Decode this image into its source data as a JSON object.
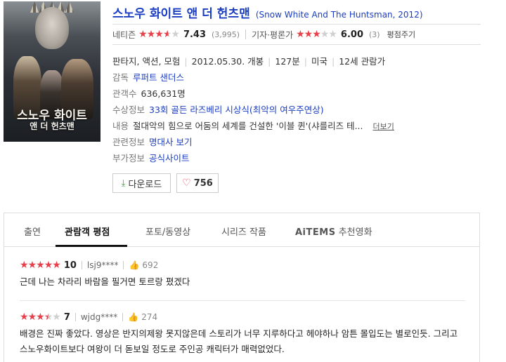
{
  "movie": {
    "title_ko": "스노우 화이트 앤 더 헌츠맨",
    "title_en": "(Snow White And The Huntsman, 2012)",
    "poster_title": "스노우 화이트",
    "poster_subtitle": "앤 더 헌츠맨"
  },
  "ratings": {
    "netizen": {
      "label": "네티즌",
      "score": "7.43",
      "count": "(3,995)",
      "stars": 3.7
    },
    "critic": {
      "label": "기자·평론가",
      "score": "6.00",
      "count": "(3)",
      "stars": 3.0
    },
    "rate_button": "평점주기"
  },
  "info": {
    "genre": "판타지, 액션, 모험",
    "release": "2012.05.30. 개봉",
    "runtime": "127분",
    "country": "미국",
    "age": "12세 관람가",
    "director_label": "감독",
    "director": "루퍼트 샌더스",
    "audience_label": "관객수",
    "audience": "636,631명",
    "awards_label": "수상정보",
    "awards": "33회 골든 라즈베리 시상식(최악의 여우주연상)",
    "plot_label": "내용",
    "plot": "절대악의 힘으로 어둠의 세계를 건설한 '이블 퀸'(샤를리즈 테...",
    "more": "더보기",
    "related_label": "관련정보",
    "related": "명대사 보기",
    "extra_label": "부가정보",
    "extra": "공식사이트"
  },
  "actions": {
    "download": "다운로드",
    "likes": "756"
  },
  "tabs": [
    {
      "label": "출연"
    },
    {
      "label": "관람객 평점"
    },
    {
      "label": "포토/동영상"
    },
    {
      "label": "시리즈 작품"
    },
    {
      "label_a": "AiTEMS",
      "label_b": " 추천영화"
    }
  ],
  "reviews": [
    {
      "score": "10",
      "stars": 5,
      "user": "lsj9****",
      "likes": "692",
      "text": "근데 나는 차라리 바람을 필거면 토르랑 폈겠다"
    },
    {
      "score": "7",
      "stars": 3.5,
      "user": "wjdg****",
      "likes": "274",
      "text": "배경은 진짜 좋았다. 영상은 반지의제왕 못지않은데 스토리가 너무 지루하다고 헤야하나 암튼 몰입도는 별로인듯. 그리고 스노우화이트보다 여왕이 더 돋보일 정도로 주인공 캐릭터가 매력없었다."
    }
  ],
  "colors": {
    "link": "#1a3dc1",
    "star": "#e8404a",
    "star_empty": "#cfcfcf"
  }
}
